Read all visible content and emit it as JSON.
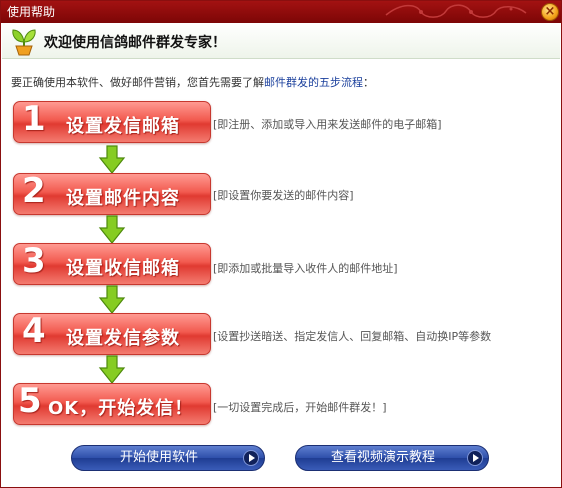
{
  "window": {
    "title": "使用帮助"
  },
  "header": {
    "welcome": "欢迎使用信鸽邮件群发专家！"
  },
  "intro": {
    "text": "要正确使用本软件、做好邮件营销，您首先需要了解",
    "link": "邮件群发的五步流程",
    "suffix": "："
  },
  "steps": [
    {
      "number": "1",
      "label": "设置发信邮箱",
      "desc": "[即注册、添加或导入用来发送邮件的电子邮箱]"
    },
    {
      "number": "2",
      "label": "设置邮件内容",
      "desc": "[即设置你要发送的邮件内容]"
    },
    {
      "number": "3",
      "label": "设置收信邮箱",
      "desc": "[即添加或批量导入收件人的邮件地址]"
    },
    {
      "number": "4",
      "label": "设置发信参数",
      "desc": "[设置抄送暗送、指定发信人、回复邮箱、自动换IP等参数"
    },
    {
      "number": "5",
      "label": "OK，开始发信！",
      "desc": "[一切设置完成后，开始邮件群发！]"
    }
  ],
  "buttons": {
    "start": "开始使用软件",
    "video": "查看视频演示教程"
  },
  "colors": {
    "titlebar": "#8a0f0f",
    "step": "#f25a4f",
    "button": "#2e4faa",
    "arrow": "#7cc21e"
  }
}
